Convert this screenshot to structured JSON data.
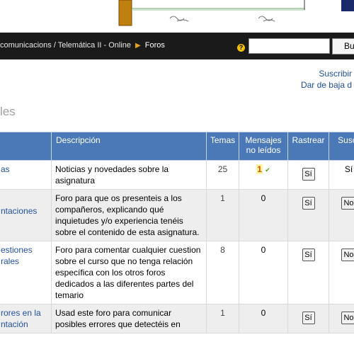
{
  "header": {
    "breadcrumb_course": "comunicacions / Telemática II - Online",
    "breadcrumb_current": "Foros",
    "search_value": "",
    "search_button": "Bu",
    "help_icon": "?"
  },
  "links": {
    "subscribe": "Suscribir",
    "unsubscribe": "Dar de baja d"
  },
  "section_heading": "les",
  "table": {
    "columns": [
      "",
      "Descripción",
      "Temas",
      "Mensajes no leídos",
      "Rastrear",
      "Suscr"
    ],
    "rows": [
      {
        "name": "as",
        "description": "Noticias y novedades sobre la asignatura",
        "temas": "25",
        "mensajes": "1",
        "rastrear": "Sí",
        "suscr": "Sí"
      },
      {
        "name": "ntaciones",
        "description": "Foro para que os presenteis a los compañeros, explicando qué inquietudes y/o experiencia tenéis sobre el contenido de esta asignatura.",
        "temas": "1",
        "mensajes": "0",
        "rastrear": "Sí",
        "suscr": "No"
      },
      {
        "name": "estiones rales",
        "description": "Foro para comentar cualquier cuestion sobre el curso que no tenga relación específica con los otros foros dedicados a las diferentes partes del temario",
        "temas": "8",
        "mensajes": "0",
        "rastrear": "Sí",
        "suscr": "No"
      },
      {
        "name": "rores en la ntación",
        "description": "Usad este foro para comunicar posibles errores que detectéis en",
        "temas": "1",
        "mensajes": "0",
        "rastrear": "Sí",
        "suscr": "No"
      }
    ]
  },
  "colors": {
    "navbar": "#1a1a1a",
    "table_header": "#4b79b8",
    "link": "#1f4f9a",
    "row_alt": "#eeeeee"
  }
}
